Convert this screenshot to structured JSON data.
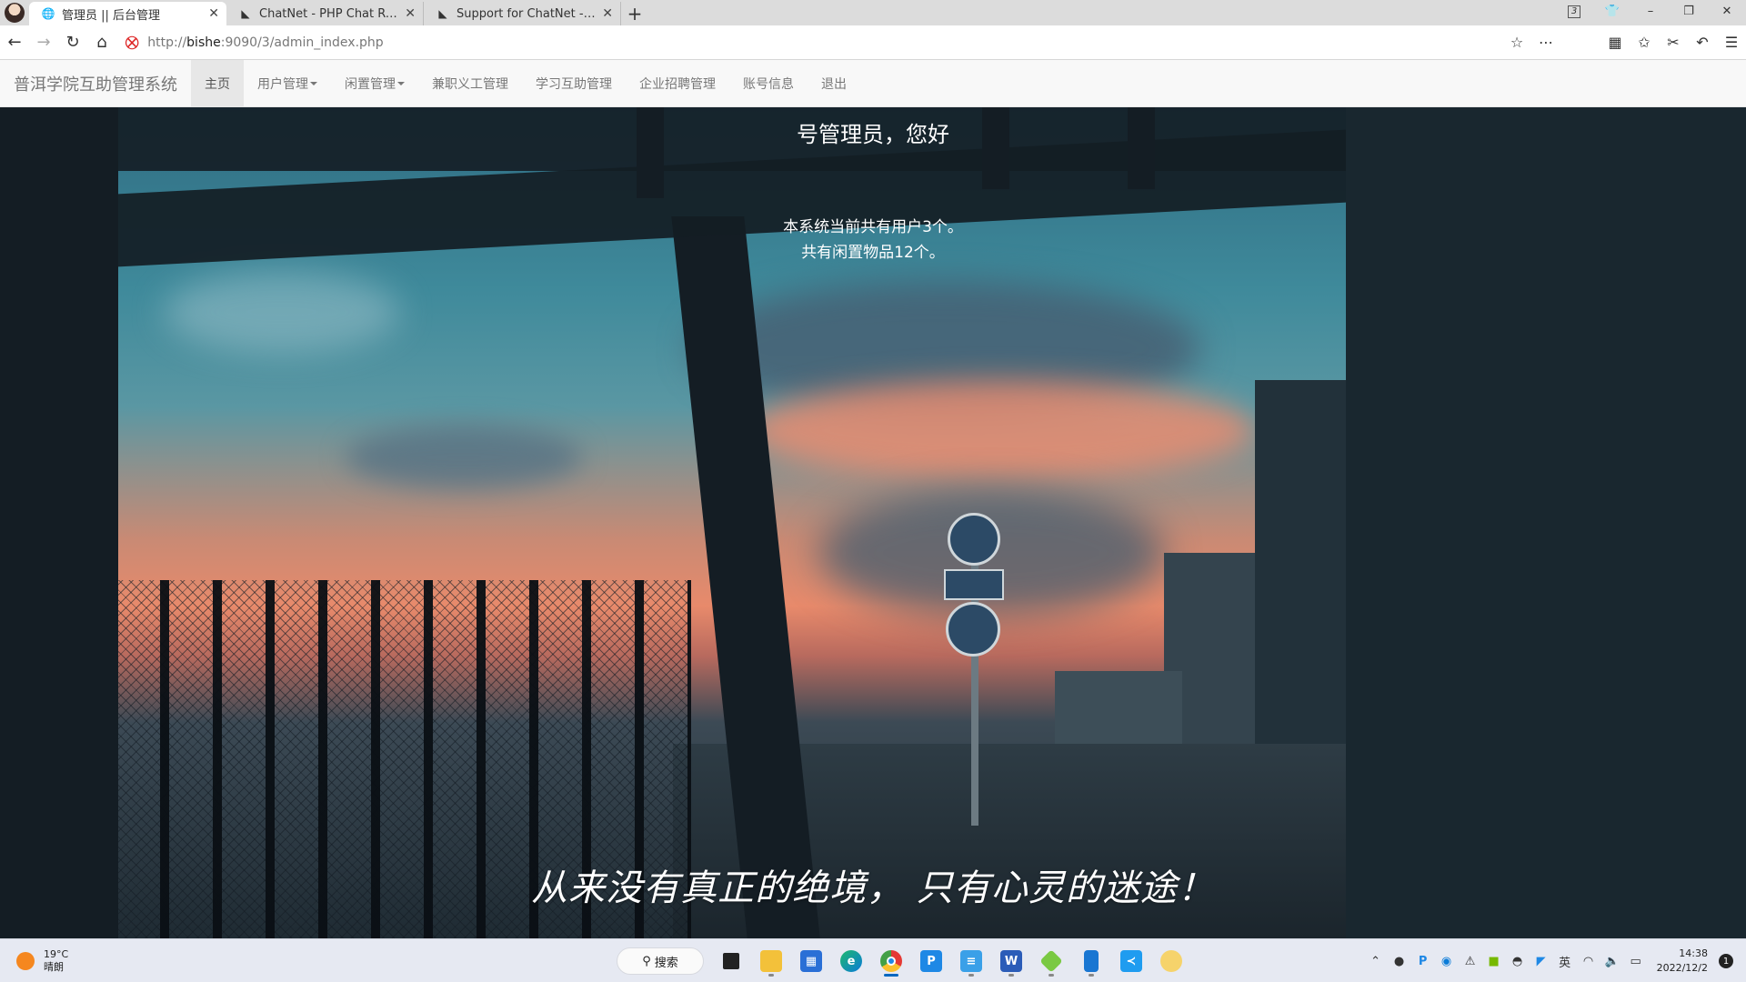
{
  "browser": {
    "tabs": [
      {
        "title": "管理员 || 后台管理",
        "active": true
      },
      {
        "title": "ChatNet - PHP Chat Room",
        "active": false
      },
      {
        "title": "Support for ChatNet - PHP",
        "active": false
      }
    ],
    "new_tab": "+",
    "url_prefix": "http://",
    "url_host": "bishe",
    "url_rest": ":9090/3/admin_index.php",
    "window_badge": "3"
  },
  "site": {
    "brand": "普洱学院互助管理系统",
    "nav": [
      {
        "label": "主页",
        "active": true,
        "dropdown": false
      },
      {
        "label": "用户管理",
        "active": false,
        "dropdown": true
      },
      {
        "label": "闲置管理",
        "active": false,
        "dropdown": true
      },
      {
        "label": "兼职义工管理",
        "active": false,
        "dropdown": false
      },
      {
        "label": "学习互助管理",
        "active": false,
        "dropdown": false
      },
      {
        "label": "企业招聘管理",
        "active": false,
        "dropdown": false
      },
      {
        "label": "账号信息",
        "active": false,
        "dropdown": false
      },
      {
        "label": "退出",
        "active": false,
        "dropdown": false
      }
    ]
  },
  "main": {
    "greeting": "号管理员，您好",
    "stat_users": "本系统当前共有用户3个。",
    "stat_items": "共有闲置物品12个。",
    "motto": "从来没有真正的绝境， 只有心灵的迷途！"
  },
  "taskbar": {
    "temp": "19°C",
    "weather": "晴朗",
    "search_label": "搜索",
    "ime": "英",
    "time": "14:38",
    "date": "2022/12/2",
    "notifications": "1",
    "apps": [
      "start",
      "search",
      "task-view",
      "file-explorer",
      "store",
      "edge",
      "chrome",
      "app-p",
      "notepad",
      "word",
      "app-green",
      "phone-link",
      "vscode",
      "app-yellow"
    ]
  }
}
